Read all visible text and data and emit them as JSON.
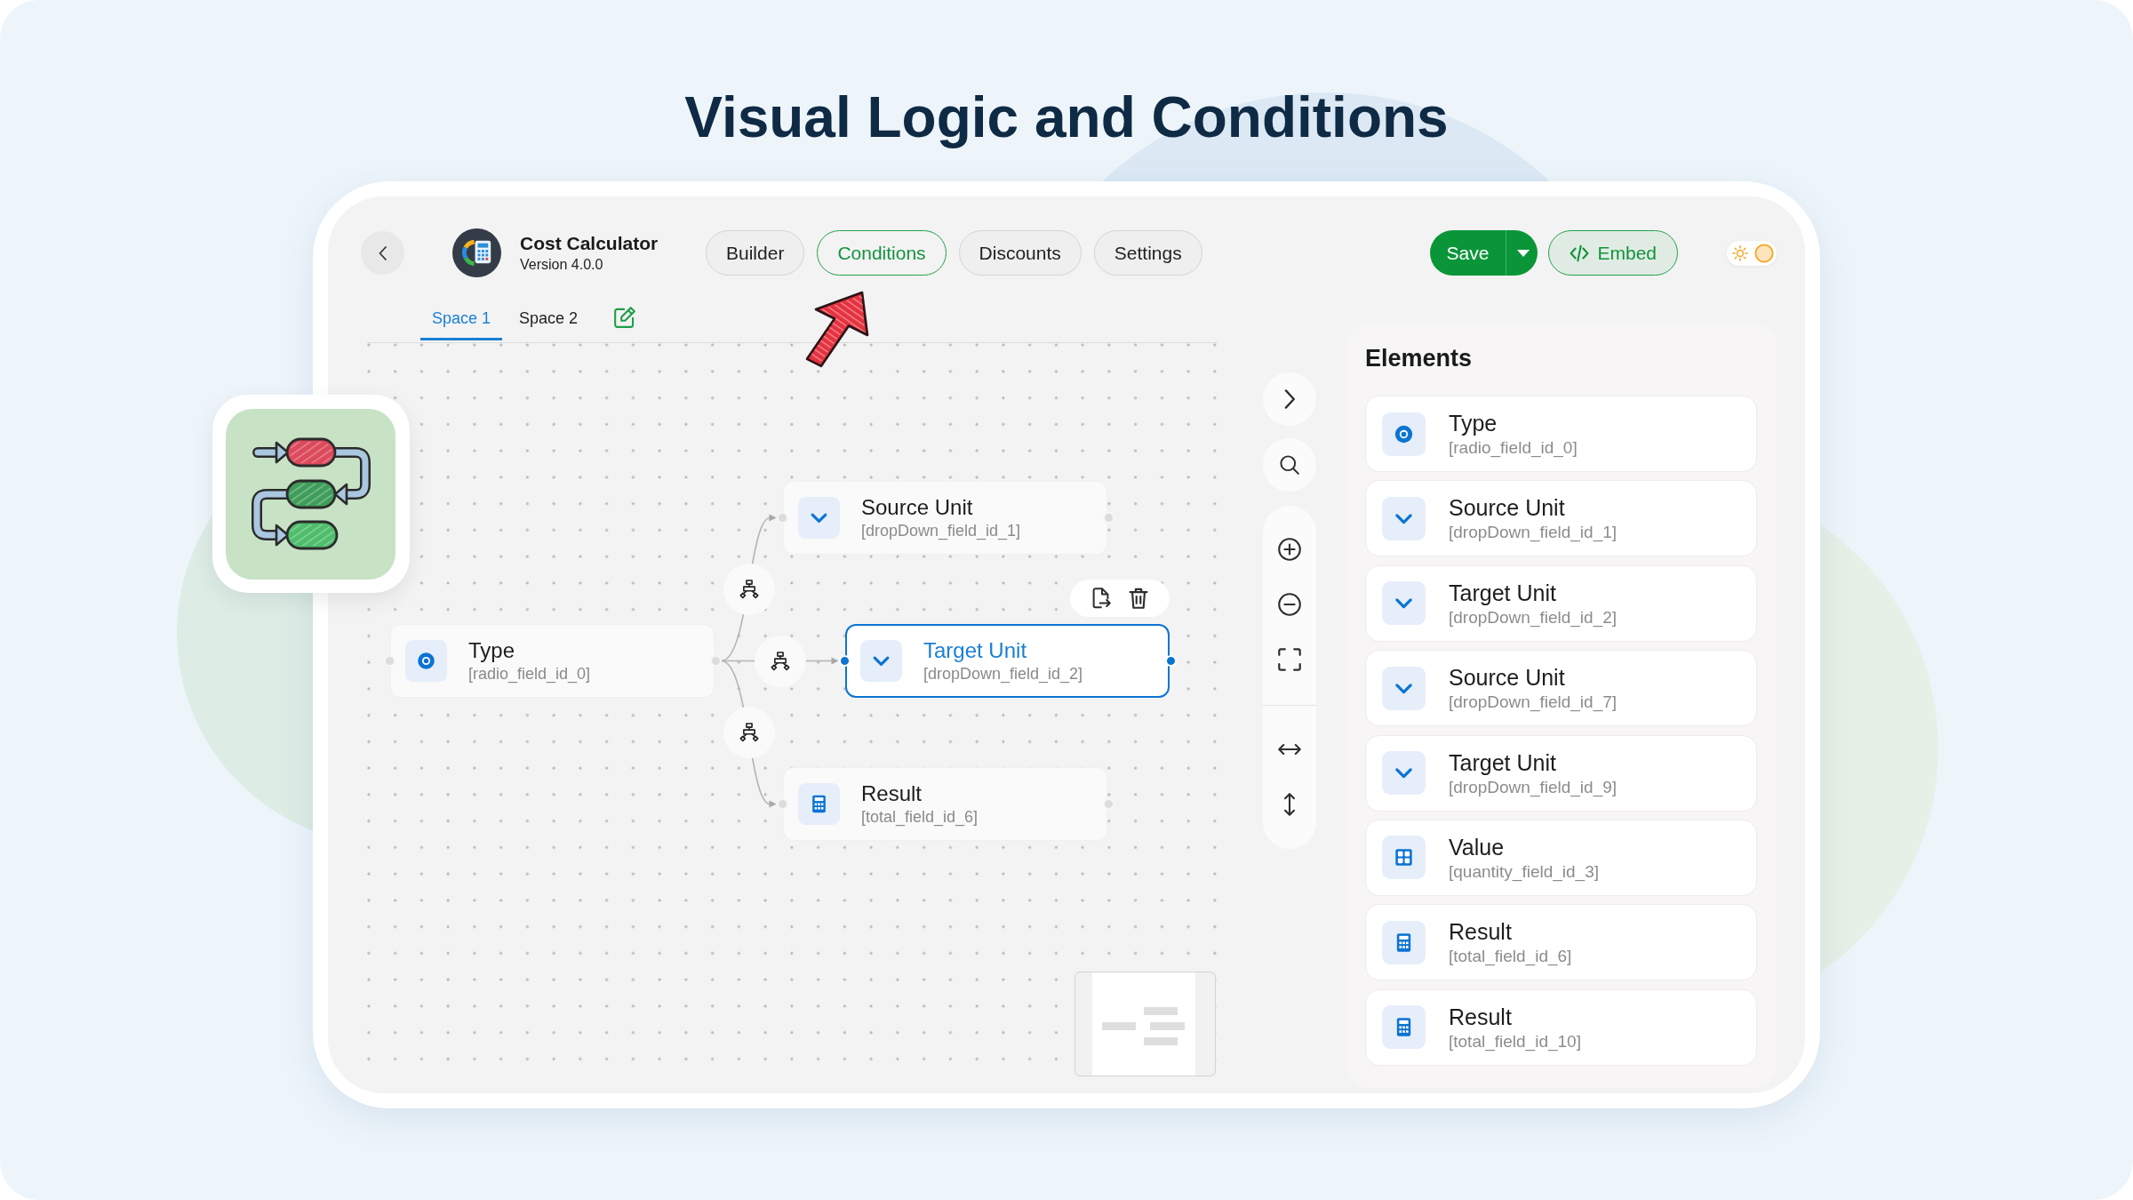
{
  "page_title": "Visual Logic and Conditions",
  "app": {
    "name": "Cost Calculator",
    "version": "Version 4.0.0"
  },
  "nav_tabs": [
    {
      "label": "Builder",
      "selected": false
    },
    {
      "label": "Conditions",
      "selected": true
    },
    {
      "label": "Discounts",
      "selected": false
    },
    {
      "label": "Settings",
      "selected": false
    }
  ],
  "actions": {
    "save": "Save",
    "embed": "Embed"
  },
  "theme_toggle": {
    "on": true
  },
  "spaces": [
    {
      "label": "Space 1",
      "selected": true
    },
    {
      "label": "Space 2",
      "selected": false
    }
  ],
  "canvas": {
    "root": {
      "label": "Type",
      "field": "[radio_field_id_0]",
      "kind": "radio",
      "selected": false,
      "children": [
        {
          "label": "Source Unit",
          "field": "[dropDown_field_id_1]",
          "kind": "dropdown",
          "selected": false
        },
        {
          "label": "Target Unit",
          "field": "[dropDown_field_id_2]",
          "kind": "dropdown",
          "selected": true
        },
        {
          "label": "Result",
          "field": "[total_field_id_6]",
          "kind": "total",
          "selected": false
        }
      ]
    }
  },
  "elements": {
    "title": "Elements",
    "items": [
      {
        "label": "Type",
        "field": "[radio_field_id_0]",
        "kind": "radio"
      },
      {
        "label": "Source Unit",
        "field": "[dropDown_field_id_1]",
        "kind": "dropdown"
      },
      {
        "label": "Target Unit",
        "field": "[dropDown_field_id_2]",
        "kind": "dropdown"
      },
      {
        "label": "Source Unit",
        "field": "[dropDown_field_id_7]",
        "kind": "dropdown"
      },
      {
        "label": "Target Unit",
        "field": "[dropDown_field_id_9]",
        "kind": "dropdown"
      },
      {
        "label": "Value",
        "field": "[quantity_field_id_3]",
        "kind": "quantity"
      },
      {
        "label": "Result",
        "field": "[total_field_id_6]",
        "kind": "total"
      },
      {
        "label": "Result",
        "field": "[total_field_id_10]",
        "kind": "total"
      }
    ]
  }
}
